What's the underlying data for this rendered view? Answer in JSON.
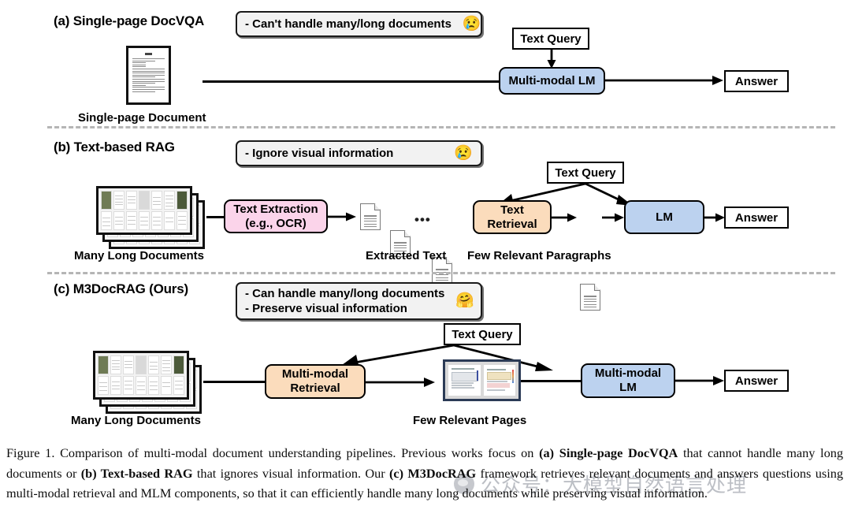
{
  "sections": [
    {
      "id": "a",
      "title": "(a) Single-page DocVQA",
      "note": {
        "lines": [
          "- Can't handle many/long documents"
        ],
        "emoji": "😢"
      },
      "source_label": "Single-page Document",
      "query_label": "Text Query",
      "model_label": "Multi-modal LM",
      "answer_label": "Answer"
    },
    {
      "id": "b",
      "title": "(b) Text-based RAG",
      "note": {
        "lines": [
          "- Ignore visual information"
        ],
        "emoji": "😢"
      },
      "source_label": "Many Long Documents",
      "extraction_label": "Text Extraction\n(e.g., OCR)",
      "extraction_line1": "Text Extraction",
      "extraction_line2": "(e.g., OCR)",
      "extracted_label": "Extracted Text",
      "retrieval_line1": "Text",
      "retrieval_line2": "Retrieval",
      "paragraphs_label": "Few Relevant Paragraphs",
      "query_label": "Text Query",
      "model_label": "LM",
      "answer_label": "Answer",
      "ellipsis": "•••"
    },
    {
      "id": "c",
      "title": "(c) M3DocRAG (Ours)",
      "note": {
        "lines": [
          "- Can handle many/long documents",
          "- Preserve visual information"
        ],
        "emoji": "🤗"
      },
      "source_label": "Many Long Documents",
      "retrieval_line1": "Multi-modal",
      "retrieval_line2": "Retrieval",
      "pages_label": "Few Relevant Pages",
      "query_label": "Text Query",
      "model_line1": "Multi-modal",
      "model_line2": "LM",
      "answer_label": "Answer"
    }
  ],
  "caption": {
    "p1": "Figure 1. Comparison of multi-modal document understanding pipelines. Previous works focus on ",
    "b1": "(a) Single-page DocVQA",
    "p2": " that cannot handle many long documents or ",
    "b2": "(b) Text-based RAG",
    "p3": " that ignores visual information. Our ",
    "b3": "(c) M3DocRAG",
    "p4": " framework retrieves relevant documents and answers questions using multi-modal retrieval and MLM components, so that it can efficiently handle many long documents while preserving visual information."
  },
  "watermark": {
    "text": "公众号：大模型自然语言处理",
    "icon": "wechat-icon"
  },
  "colors": {
    "blue_box": "#bcd2ef",
    "pink_box": "#fbd4ea",
    "orange_box": "#fbdcbc",
    "note_bg": "#f2f2f2",
    "divider": "#b5b5b5",
    "outline": "#000000"
  }
}
